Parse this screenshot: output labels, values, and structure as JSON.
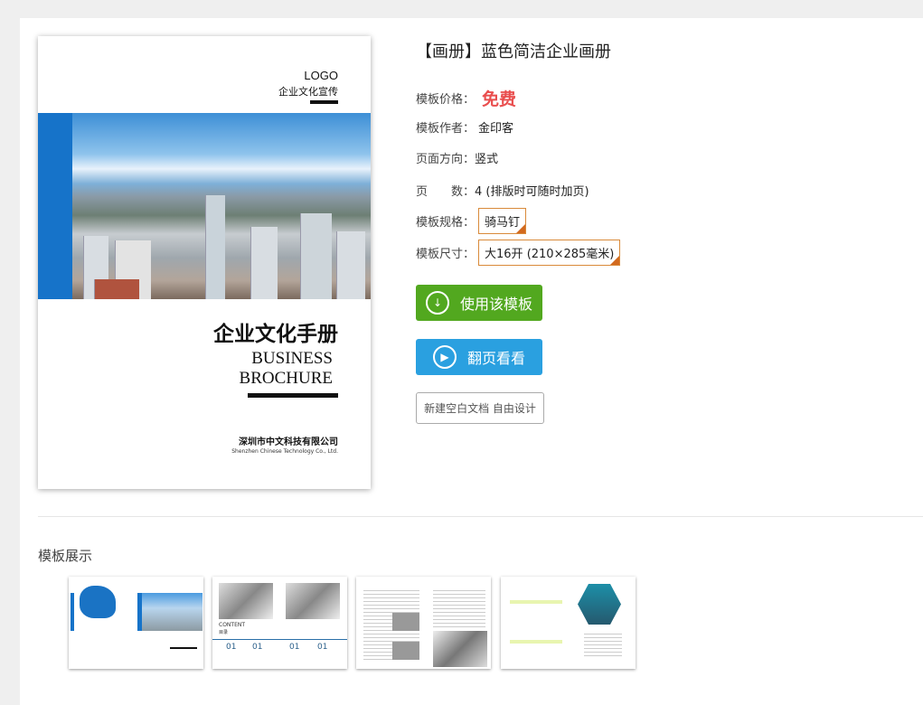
{
  "cover": {
    "logo": "LOGO",
    "slogan": "企业文化宣传",
    "title": "企业文化手册",
    "en_line1": "BUSINESS",
    "en_line2": "BROCHURE",
    "company": "深圳市中文科技有限公司",
    "company_en": "Shenzhen Chinese Technology Co., Ltd."
  },
  "detail": {
    "title": "【画册】蓝色简洁企业画册",
    "price_label": "模板价格：",
    "price": "免费",
    "author_label": "模板作者：",
    "author": "金印客",
    "orientation_label": "页面方向：",
    "orientation": "竖式",
    "pages_label": "页　　数：",
    "pages": "4 (排版时可随时加页)",
    "spec_label": "模板规格：",
    "spec": "骑马钉",
    "size_label": "模板尺寸：",
    "size": "大16开 (210×285毫米)",
    "use_button": "使用该模板",
    "flip_button": "翻页看看",
    "blank_button": "新建空白文档 自由设计"
  },
  "colors": {
    "green": "#52a81f",
    "blue": "#2aa0e0",
    "red": "#e94e4e",
    "brand_blue": "#1673c9"
  },
  "showcase": {
    "title": "模板展示",
    "thumb2": {
      "content": "CONTENT",
      "mulu": "目录",
      "nums": [
        "01",
        "01",
        "01",
        "01"
      ]
    }
  }
}
